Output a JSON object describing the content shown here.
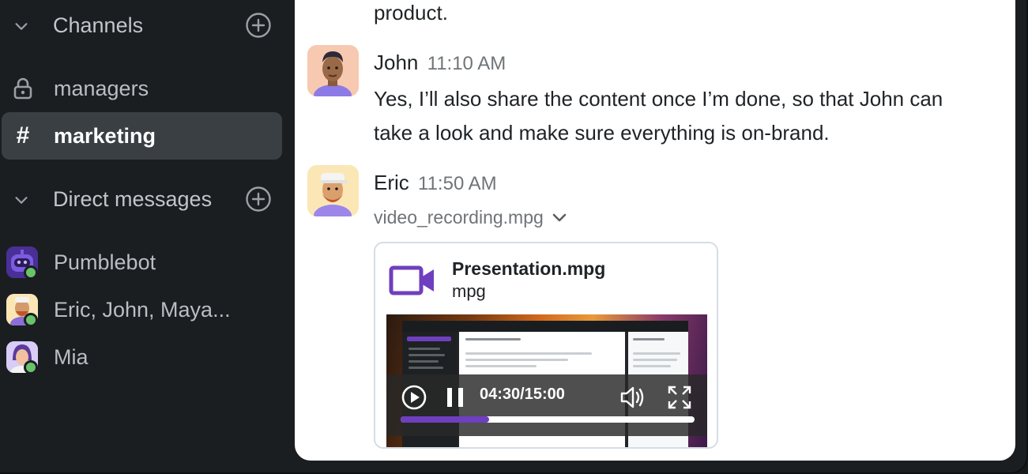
{
  "sidebar": {
    "channels_header": "Channels",
    "channels": [
      {
        "label": "managers",
        "icon": "lock-icon"
      },
      {
        "label": "marketing",
        "icon": "hash-icon",
        "active": true
      }
    ],
    "dm_header": "Direct messages",
    "direct_messages": [
      {
        "label": "Pumblebot",
        "icon": "bot-avatar"
      },
      {
        "label": "Eric, John, Maya...",
        "icon": "group-avatar"
      },
      {
        "label": "Mia",
        "icon": "mia-avatar"
      }
    ],
    "hash_glyph": "#"
  },
  "messages": {
    "prev_text_tail": "product.",
    "john": {
      "author": "John",
      "time": "11:10 AM",
      "text_line1": "Yes, I’ll also share the content once I’m done, so that John can",
      "text_line2": "take a look and make sure everything is on-brand."
    },
    "eric": {
      "author": "Eric",
      "time": "11:50 AM",
      "file_label": "video_recording.mpg",
      "attachment": {
        "title": "Presentation.mpg",
        "ext": "mpg",
        "timecode": "04:30/15:00",
        "progress": 0.3
      }
    }
  },
  "colors": {
    "sidebar_bg": "#1a1e21",
    "active_item": "#3a3f44",
    "accent_purple": "#6f3fbf",
    "online": "#6ac36a"
  }
}
